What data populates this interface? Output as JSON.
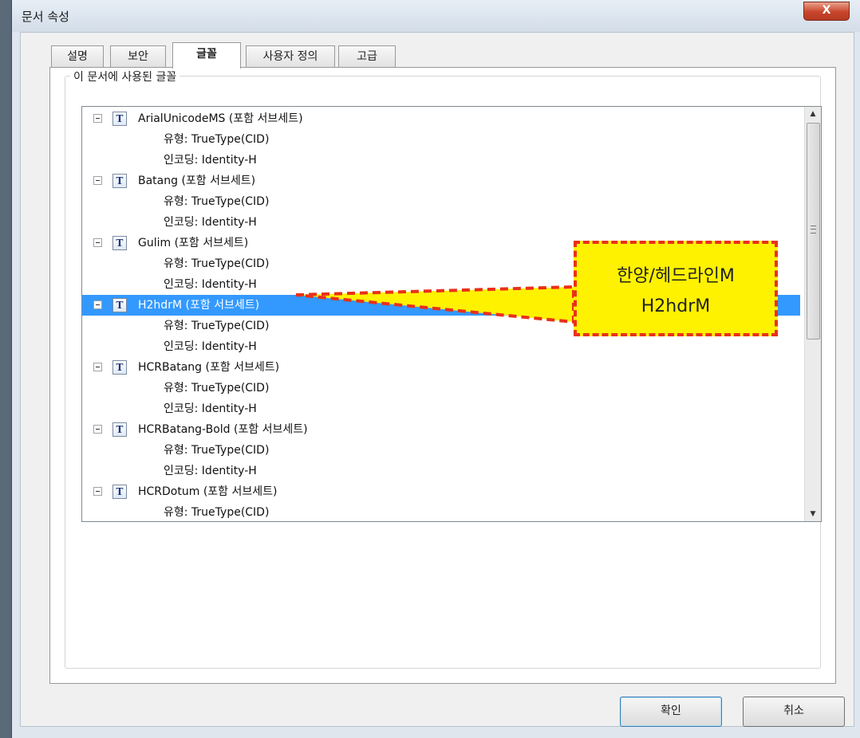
{
  "window": {
    "title": "문서 속성",
    "close_label": "X"
  },
  "tabs": [
    {
      "label": "설명",
      "active": false
    },
    {
      "label": "보안",
      "active": false
    },
    {
      "label": "글꼴",
      "active": true
    },
    {
      "label": "사용자 정의",
      "active": false
    },
    {
      "label": "고급",
      "active": false
    }
  ],
  "fonts_group": {
    "label": "이 문서에 사용된 글꼴"
  },
  "fonts": [
    {
      "name": "ArialUnicodeMS (포함 서브세트)",
      "type": "유형: TrueType(CID)",
      "encoding": "인코딩: Identity-H"
    },
    {
      "name": "Batang (포함 서브세트)",
      "type": "유형: TrueType(CID)",
      "encoding": "인코딩: Identity-H"
    },
    {
      "name": "Gulim (포함 서브세트)",
      "type": "유형: TrueType(CID)",
      "encoding": "인코딩: Identity-H"
    },
    {
      "name": "H2hdrM (포함 서브세트)",
      "type": "유형: TrueType(CID)",
      "encoding": "인코딩: Identity-H",
      "selected": true
    },
    {
      "name": "HCRBatang (포함 서브세트)",
      "type": "유형: TrueType(CID)",
      "encoding": "인코딩: Identity-H"
    },
    {
      "name": "HCRBatang-Bold (포함 서브세트)",
      "type": "유형: TrueType(CID)",
      "encoding": "인코딩: Identity-H"
    },
    {
      "name": "HCRDotum (포함 서브세트)",
      "type": "유형: TrueType(CID)"
    }
  ],
  "font_icon_glyph": "T",
  "callout": {
    "line1": "한양/헤드라인M",
    "line2": "H2hdrM"
  },
  "buttons": {
    "ok": "확인",
    "cancel": "취소"
  },
  "colors": {
    "selection": "#3399ff",
    "callout_fill": "#fff200",
    "callout_border": "#e9301a"
  }
}
